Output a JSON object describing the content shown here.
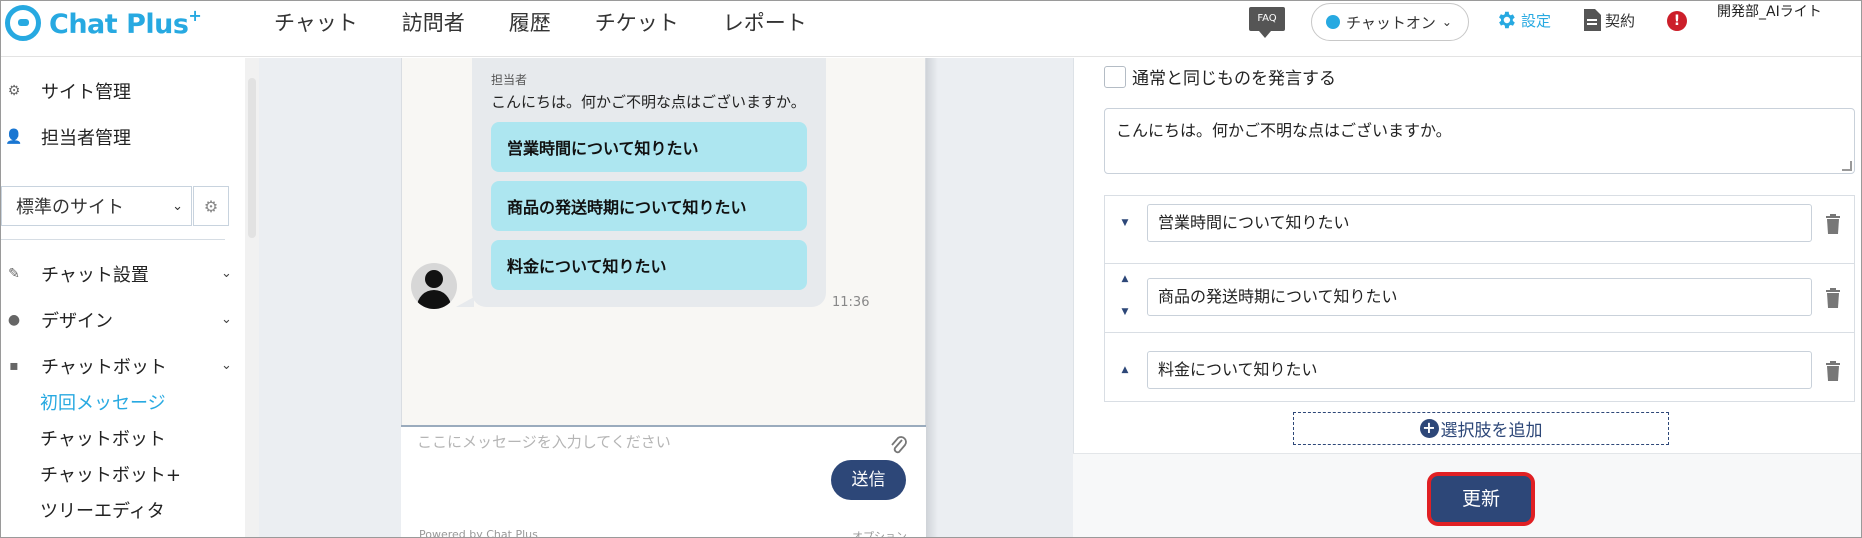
{
  "app": {
    "logo_text": "Chat Plus",
    "logo_sup": "+"
  },
  "nav": {
    "items": [
      "チャット",
      "訪問者",
      "履歴",
      "チケット",
      "レポート"
    ]
  },
  "header": {
    "faq_label": "FAQ",
    "status_label": "チャットオン",
    "settings_label": "設定",
    "contract_label": "契約",
    "alert_label": "!",
    "user_label": "開発部_AIライト"
  },
  "sidebar": {
    "site_mgmt": "サイト管理",
    "staff_mgmt": "担当者管理",
    "site_select": "標準のサイト",
    "sections": [
      {
        "label": "チャット設置"
      },
      {
        "label": "デザイン"
      },
      {
        "label": "チャットボット"
      }
    ],
    "sub_items": [
      {
        "label": "初回メッセージ",
        "active": true
      },
      {
        "label": "チャットボット"
      },
      {
        "label": "チャットボット+"
      },
      {
        "label": "ツリーエディタ"
      }
    ]
  },
  "preview": {
    "sender": "担当者",
    "message": "こんにちは。何かご不明な点はございますか。",
    "choices": [
      "営業時間について知りたい",
      "商品の発送時期について知りたい",
      "料金について知りたい"
    ],
    "time": "11:36",
    "input_placeholder": "ここにメッセージを入力してください",
    "send_label": "送信",
    "powered_by": "Powered by Chat Plus",
    "option_label": "オプション"
  },
  "editor": {
    "same_as_normal_label": "通常と同じものを発言する",
    "message_text": "こんにちは。何かご不明な点はございますか。",
    "choices": [
      "営業時間について知りたい",
      "商品の発送時期について知りたい",
      "料金について知りたい"
    ],
    "add_choice_label": "選択肢を追加",
    "update_label": "更新"
  },
  "colors": {
    "brand": "#27a9e1",
    "primary_button": "#2d4778",
    "choice_bubble": "#ade6f0",
    "highlight_border": "#e02024"
  }
}
